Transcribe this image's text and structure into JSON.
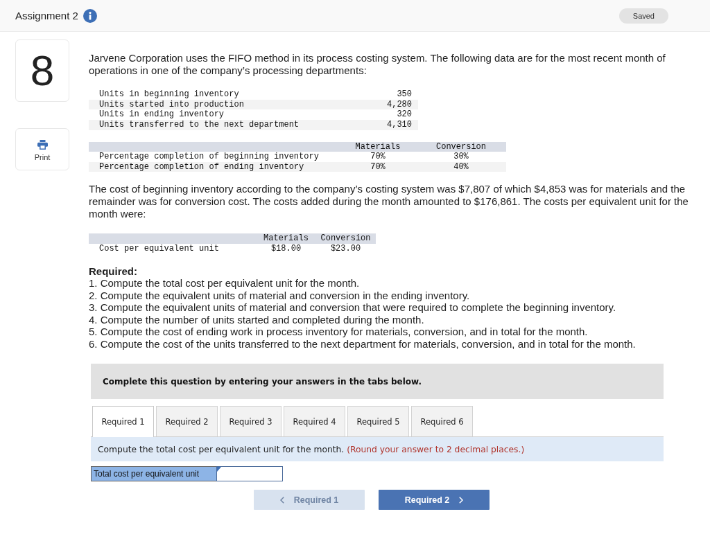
{
  "header": {
    "title": "Assignment 2",
    "status": "Saved"
  },
  "sidebar": {
    "question_number": "8",
    "print_label": "Print"
  },
  "question": {
    "intro": "Jarvene Corporation uses the FIFO method in its process costing system. The following data are for the most recent month of operations in one of the company’s processing departments:",
    "units_table": {
      "rows": [
        {
          "label": "Units in beginning inventory",
          "value": "350"
        },
        {
          "label": "Units started into production",
          "value": "4,280"
        },
        {
          "label": "Units in ending inventory",
          "value": "320"
        },
        {
          "label": "Units transferred to the next department",
          "value": "4,310"
        }
      ]
    },
    "completion_table": {
      "columns": [
        "Materials",
        "Conversion"
      ],
      "rows": [
        {
          "label": "Percentage completion of beginning inventory",
          "values": [
            "70%",
            "30%"
          ]
        },
        {
          "label": "Percentage completion of ending inventory",
          "values": [
            "70%",
            "40%"
          ]
        }
      ]
    },
    "cost_text": "The cost of beginning inventory according to the company’s costing system was $7,807 of which $4,853 was for materials and the remainder was for conversion cost. The costs added during the month amounted to $176,861. The costs per equivalent unit for the month were:",
    "cost_table": {
      "columns": [
        "Materials",
        "Conversion"
      ],
      "rows": [
        {
          "label": "Cost per equivalent unit",
          "values": [
            "$18.00",
            "$23.00"
          ]
        }
      ]
    },
    "required": {
      "heading": "Required:",
      "items": [
        "1. Compute the total cost per equivalent unit for the month.",
        "2. Compute the equivalent units of material and conversion in the ending inventory.",
        "3. Compute the equivalent units of material and conversion that were required to complete the beginning inventory.",
        "4. Compute the number of units started and completed during the month.",
        "5. Compute the cost of ending work in process inventory for materials, conversion, and in total for the month.",
        "6. Compute the cost of the units transferred to the next department for materials, conversion, and in total for the month."
      ]
    }
  },
  "answer_panel": {
    "banner": "Complete this question by entering your answers in the tabs below.",
    "tabs": [
      {
        "label": "Required 1",
        "selected": true
      },
      {
        "label": "Required 2",
        "selected": false
      },
      {
        "label": "Required 3",
        "selected": false
      },
      {
        "label": "Required 4",
        "selected": false
      },
      {
        "label": "Required 5",
        "selected": false
      },
      {
        "label": "Required 6",
        "selected": false
      }
    ],
    "instruction": "Compute the total cost per equivalent unit for the month.",
    "hint": "(Round your answer to 2 decimal places.)",
    "fields": [
      {
        "label": "Total cost per equivalent unit"
      }
    ],
    "prev_button": {
      "label": "Required 1",
      "disabled": true
    },
    "next_button": {
      "label": "Required 2",
      "disabled": false
    }
  }
}
